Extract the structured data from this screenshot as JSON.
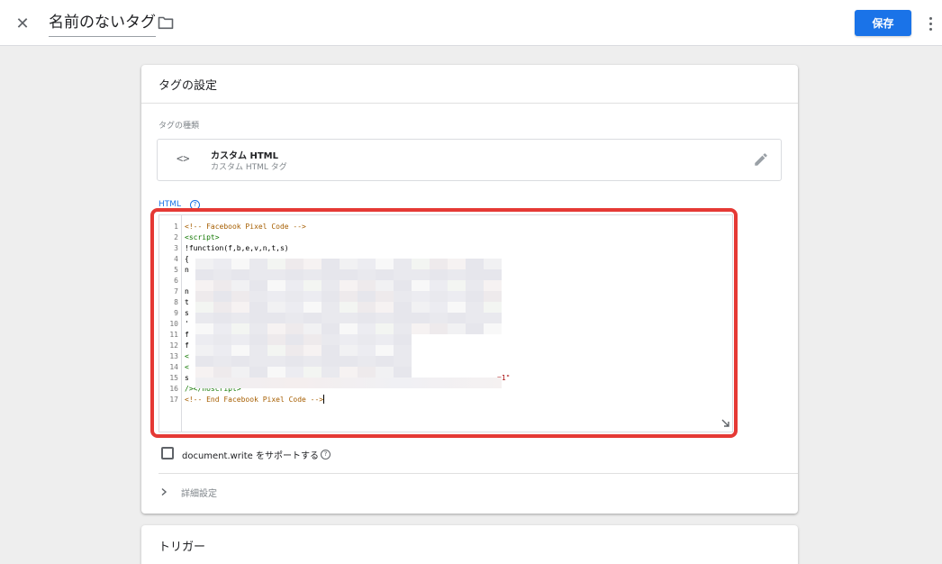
{
  "header": {
    "tag_name": "名前のないタグ",
    "save_label": "保存"
  },
  "tag_config": {
    "title": "タグの設定",
    "type_section_label": "タグの種類",
    "type_name": "カスタム HTML",
    "type_subtitle": "カスタム HTML タグ",
    "html_label": "HTML",
    "help_glyph": "?",
    "code_lines": [
      {
        "n": "1",
        "text": "<!-- Facebook Pixel Code -->"
      },
      {
        "n": "2",
        "text": "<script>"
      },
      {
        "n": "3",
        "text": "!function(f,b,e,v,n,t,s)"
      },
      {
        "n": "4",
        "text": "{"
      },
      {
        "n": "5",
        "text": "n"
      },
      {
        "n": "6",
        "text": ""
      },
      {
        "n": "7",
        "text": "n"
      },
      {
        "n": "8",
        "text": "t"
      },
      {
        "n": "9",
        "text": "s"
      },
      {
        "n": "10",
        "text": "'"
      },
      {
        "n": "11",
        "text": "f"
      },
      {
        "n": "12",
        "text": "f"
      },
      {
        "n": "13",
        "text": "<"
      },
      {
        "n": "14",
        "text": "<"
      },
      {
        "n": "15",
        "text": "s",
        "tail": "=1\""
      },
      {
        "n": "16",
        "text": "/></noscript>"
      },
      {
        "n": "17",
        "text": "<!-- End Facebook Pixel Code -->"
      }
    ],
    "doc_write_label": "document.write をサポートする",
    "advanced_label": "詳細設定"
  },
  "trigger": {
    "title": "トリガー"
  },
  "colors": {
    "accent": "#1a73e8",
    "highlight": "#e53935"
  }
}
